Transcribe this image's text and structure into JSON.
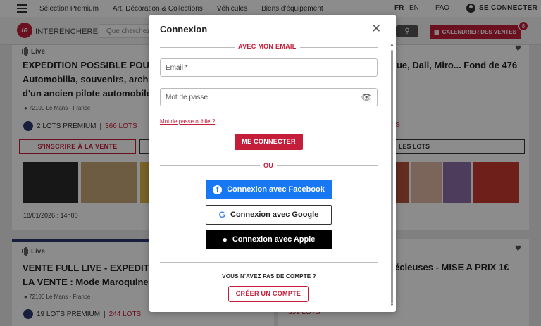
{
  "topnav": {
    "links": [
      "Sélection Premium",
      "Art, Décoration & Collections",
      "Véhicules",
      "Biens d'équipement"
    ],
    "lang_fr": "FR",
    "lang_en": "EN",
    "faq": "FAQ",
    "connect_label": "SE CONNECTER"
  },
  "header": {
    "logo_text": "INTERENCHERES",
    "logo_mark": "ie",
    "search_placeholder": "Que cherchez",
    "calendar_label": "CALENDRIER DES VENTES",
    "calendar_badge": "8"
  },
  "cards": [
    {
      "live": "Live",
      "title_lines": [
        "EXPEDITION POSSIBLE POUR T",
        "Automobilia, souvenirs, archive",
        "d'un ancien pilote automobile"
      ],
      "location": "72100 Le Mans - France",
      "premium": "2 LOTS PREMIUM",
      "lots": "366 LOTS",
      "register_label": "S'INSCRIRE À LA VENTE",
      "date": "18/01/2026 : 14h00"
    },
    {
      "title_lines": [
        "que, Dali, Miro... Fond de 476"
      ],
      "lots": "TS",
      "lots_button": "LES LOTS"
    },
    {
      "live": "Live",
      "title_lines": [
        "VENTE FULL LIVE - EXPEDITION",
        "LA VENTE : Mode Maroquinerie"
      ],
      "location": "72100 Le Mans - France",
      "premium": "19 LOTS PREMIUM",
      "lots": "244 LOTS"
    },
    {
      "title_lines": [
        "récieuses - MISE A PRIX 1€"
      ],
      "lots": "359 LOTS"
    }
  ],
  "modal": {
    "title": "Connexion",
    "email_section": "AVEC MON EMAIL",
    "email_placeholder": "Email *",
    "password_placeholder": "Mot de passe",
    "forgot": "Mot de passe oublié ?",
    "connect_button": "ME CONNECTER",
    "or": "OU",
    "facebook": "Connexion avec Facebook",
    "google": "Connexion avec Google",
    "apple": "Connexion avec Apple",
    "no_account": "VOUS N'AVEZ PAS DE COMPTE ?",
    "create_account": "CRÉER UN COMPTE"
  },
  "colors": {
    "brand": "#c41e3a",
    "facebook": "#1877f2",
    "apple": "#000000"
  }
}
